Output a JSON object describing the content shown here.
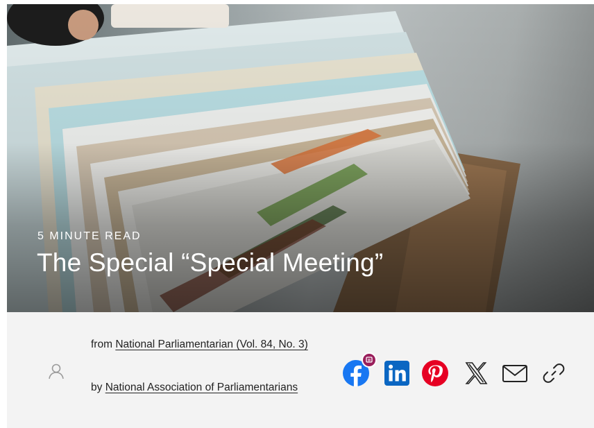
{
  "hero": {
    "kicker": "5 MINUTE READ",
    "title": "The Special “Special Meeting”"
  },
  "meta": {
    "source_prefix": "from ",
    "source_link": "National Parliamentarian (Vol. 84, No. 3)",
    "author_prefix": "by ",
    "author_link": "National Association of Parliamentarians",
    "avatar_icon": "user-icon"
  },
  "share": {
    "icons": [
      "facebook-icon",
      "linkedin-icon",
      "pinterest-icon",
      "x-icon",
      "email-icon",
      "link-icon"
    ],
    "colors": {
      "facebook": "#1877f2",
      "linkedin": "#0a66c2",
      "pinterest": "#e60023",
      "x": "#222222",
      "email": "#222222",
      "link": "#222222",
      "badge": "#9a1f5c"
    }
  }
}
